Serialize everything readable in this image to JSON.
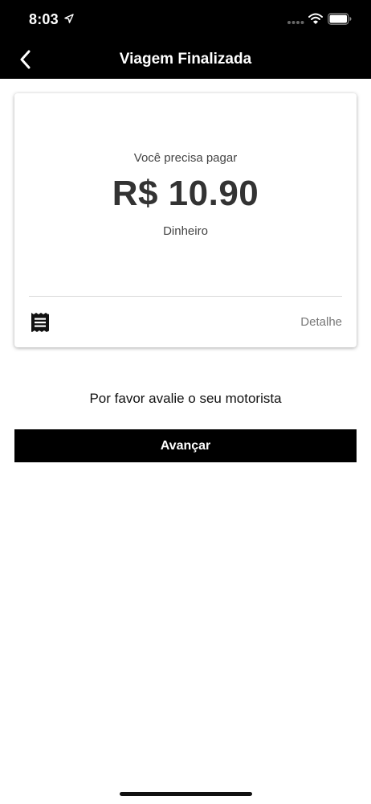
{
  "status_bar": {
    "time": "8:03",
    "icons": [
      "location-arrow-icon",
      "signal-icon",
      "wifi-icon",
      "battery-icon"
    ]
  },
  "header": {
    "title": "Viagem Finalizada",
    "back_icon": "chevron-left-icon"
  },
  "payment_card": {
    "label": "Você precisa pagar",
    "amount": "R$ 10.90",
    "method": "Dinheiro",
    "receipt_icon": "receipt-icon",
    "detail_label": "Detalhe"
  },
  "rating": {
    "prompt": "Por favor avalie o seu motorista"
  },
  "actions": {
    "advance_label": "Avançar"
  },
  "colors": {
    "header_bg": "#000000",
    "button_bg": "#000000",
    "text_primary": "#333333",
    "detail_text": "#777777"
  }
}
